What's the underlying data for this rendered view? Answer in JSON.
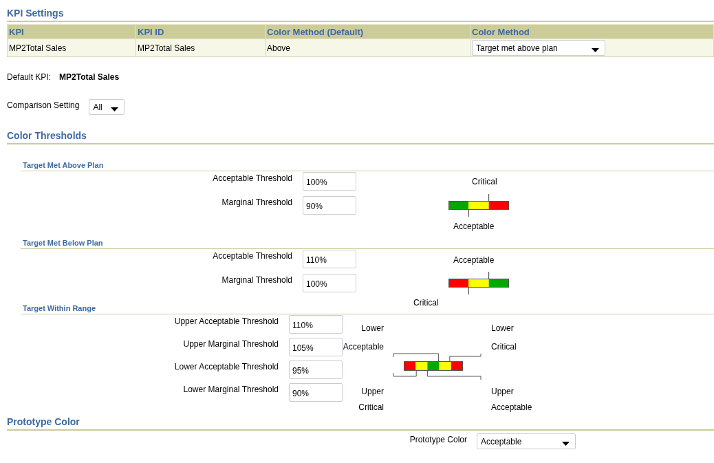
{
  "kpi_settings": {
    "title": "KPI Settings",
    "table": {
      "columns": [
        "KPI",
        "KPI ID",
        "Color Method (Default)",
        "Color Method"
      ],
      "rows": [
        {
          "kpi": "MP2Total Sales",
          "kpi_id": "MP2Total Sales",
          "default_color_method": "Above",
          "color_method": "Target met above plan"
        }
      ]
    }
  },
  "default_kpi": {
    "label": "Default KPI:",
    "value": "MP2Total Sales"
  },
  "comparison_setting": {
    "label": "Comparison Setting",
    "value": "All"
  },
  "color_thresholds": {
    "title": "Color Thresholds",
    "groups": [
      {
        "title": "Target Met Above Plan",
        "kind": "above",
        "fields": [
          {
            "label": "Acceptable Threshold",
            "value": "100%"
          },
          {
            "label": "Marginal Threshold",
            "value": "90%"
          }
        ],
        "gauge": {
          "segments": [
            {
              "color": "#00a800"
            },
            {
              "color": "#ffff00"
            },
            {
              "color": "#ff0000"
            }
          ],
          "labels": [
            {
              "text": "Critical",
              "kind": "top"
            },
            {
              "text": "Acceptable",
              "kind": "bottom"
            }
          ]
        }
      },
      {
        "title": "Target Met Below Plan",
        "kind": "below",
        "fields": [
          {
            "label": "Acceptable Threshold",
            "value": "110%"
          },
          {
            "label": "Marginal Threshold",
            "value": "100%"
          }
        ],
        "gauge": {
          "segments": [
            {
              "color": "#ff0000"
            },
            {
              "color": "#ffff00"
            },
            {
              "color": "#00a800"
            }
          ],
          "labels": [
            {
              "text": "Acceptable",
              "kind": "top"
            },
            {
              "text": "Critical",
              "kind": "bottom"
            }
          ]
        }
      },
      {
        "title": "Target Within Range",
        "kind": "range",
        "fields": [
          {
            "label": "Upper Acceptable Threshold",
            "value": "110%"
          },
          {
            "label": "Upper Marginal Threshold",
            "value": "105%"
          },
          {
            "label": "Lower Acceptable Threshold",
            "value": "95%"
          },
          {
            "label": "Lower Marginal Threshold",
            "value": "90%"
          }
        ],
        "gauge": {
          "segments": [
            {
              "color": "#ff0000"
            },
            {
              "color": "#ffff00"
            },
            {
              "color": "#00a800"
            },
            {
              "color": "#ffff00"
            },
            {
              "color": "#ff0000"
            }
          ],
          "labels": [
            {
              "text": "Lower Acceptable",
              "kind": "top-left"
            },
            {
              "text": "Lower Critical",
              "kind": "top-right"
            },
            {
              "text": "Upper Critical",
              "kind": "bottom-left"
            },
            {
              "text": "Upper Acceptable",
              "kind": "bottom-right"
            }
          ]
        }
      }
    ]
  },
  "prototype_color": {
    "title": "Prototype Color",
    "label": "Prototype Color",
    "value": "Acceptable"
  }
}
